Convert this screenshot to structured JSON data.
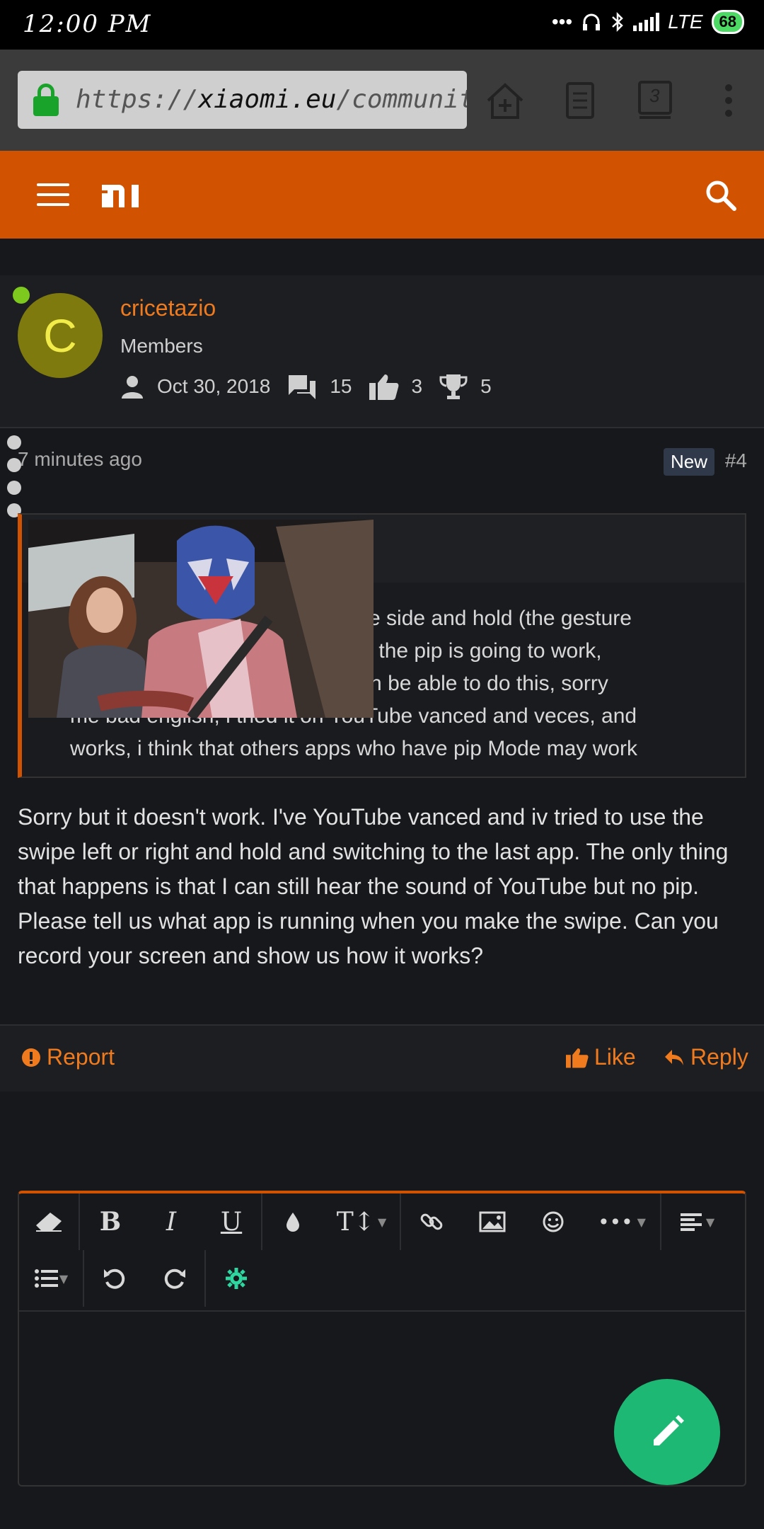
{
  "status": {
    "time": "12:00 PM",
    "network": "LTE",
    "battery": "68"
  },
  "browser": {
    "url_prefix": "https://",
    "url_domain": "xiaomi.eu",
    "url_path": "/community/th",
    "tab_count": "3"
  },
  "site": {
    "logo": "mi"
  },
  "user": {
    "initial": "C",
    "name": "cricetazio",
    "group": "Members",
    "joined": "Oct 30, 2018",
    "messages": "15",
    "likes": "3",
    "points": "5"
  },
  "post": {
    "time": "7 minutes ago",
    "badge": "New",
    "number": "#4",
    "quote_lines": [
      "n the side and hold (the gesture",
      "hen the pip is going to work,",
      "open be able to do this, sorry",
      "me bad english, i tried it on YouTube vanced and veces, and",
      "works, i think that others apps who have pip Mode may work"
    ],
    "body": "Sorry but it doesn't work. I've YouTube vanced and iv tried to use the swipe left or right and hold and switching to the last app. The only thing that happens is that I can still hear the sound of YouTube but no pip. Please tell us what app is running when you make the swipe. Can you record your screen and show us how it works?"
  },
  "actions": {
    "report": "Report",
    "like": "Like",
    "reply": "Reply"
  },
  "editor": {
    "placeholder": ""
  },
  "colors": {
    "accent": "#d15200",
    "link": "#f07b1e",
    "fab": "#1cb874",
    "online": "#7ec91e"
  }
}
